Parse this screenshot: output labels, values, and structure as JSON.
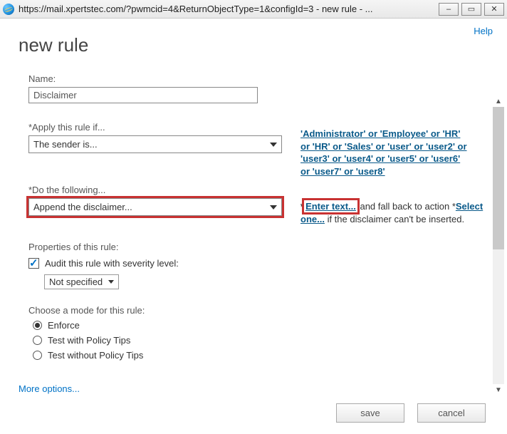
{
  "window": {
    "title": "https://mail.xpertstec.com/?pwmcid=4&ReturnObjectType=1&configId=3 - new rule - ..."
  },
  "header": {
    "help": "Help",
    "page_title": "new rule"
  },
  "form": {
    "name_label": "Name:",
    "name_value": "Disclaimer",
    "apply_if_label": "*Apply this rule if...",
    "apply_if_value": "The sender is...",
    "apply_if_summary": "'Administrator' or 'Employee' or 'HR' or 'HR' or 'Sales' or 'user' or 'user2' or 'user3' or 'user4' or 'user5' or 'user6' or 'user7' or 'user8'",
    "do_following_label": "*Do the following...",
    "do_following_value": "Append the disclaimer...",
    "action_enter_text": "Enter text...",
    "action_mid": " and fall back to action *",
    "action_select_one": "Select one...",
    "action_tail": " if the disclaimer can't be inserted.",
    "properties_label": "Properties of this rule:",
    "audit_label": "Audit this rule with severity level:",
    "severity_value": "Not specified",
    "mode_label": "Choose a mode for this rule:",
    "mode_options": {
      "enforce": "Enforce",
      "test_tips": "Test with Policy Tips",
      "test_no_tips": "Test without Policy Tips"
    },
    "more_options": "More options..."
  },
  "buttons": {
    "save": "save",
    "cancel": "cancel"
  }
}
